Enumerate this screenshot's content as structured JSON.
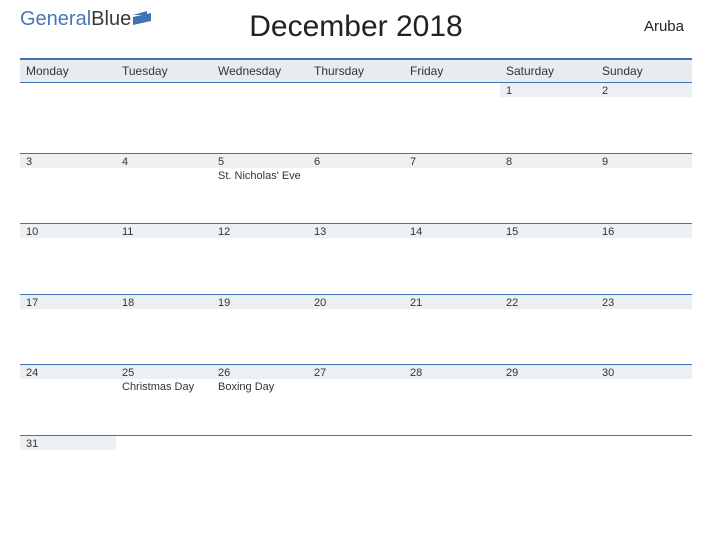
{
  "header": {
    "logo_part1": "General",
    "logo_part2": "Blue",
    "title": "December 2018",
    "region": "Aruba"
  },
  "day_headers": [
    "Monday",
    "Tuesday",
    "Wednesday",
    "Thursday",
    "Friday",
    "Saturday",
    "Sunday"
  ],
  "weeks": [
    {
      "days": [
        {
          "num": "",
          "event": ""
        },
        {
          "num": "",
          "event": ""
        },
        {
          "num": "",
          "event": ""
        },
        {
          "num": "",
          "event": ""
        },
        {
          "num": "",
          "event": ""
        },
        {
          "num": "1",
          "event": ""
        },
        {
          "num": "2",
          "event": ""
        }
      ]
    },
    {
      "days": [
        {
          "num": "3",
          "event": ""
        },
        {
          "num": "4",
          "event": ""
        },
        {
          "num": "5",
          "event": "St. Nicholas' Eve"
        },
        {
          "num": "6",
          "event": ""
        },
        {
          "num": "7",
          "event": ""
        },
        {
          "num": "8",
          "event": ""
        },
        {
          "num": "9",
          "event": ""
        }
      ]
    },
    {
      "days": [
        {
          "num": "10",
          "event": ""
        },
        {
          "num": "11",
          "event": ""
        },
        {
          "num": "12",
          "event": ""
        },
        {
          "num": "13",
          "event": ""
        },
        {
          "num": "14",
          "event": ""
        },
        {
          "num": "15",
          "event": ""
        },
        {
          "num": "16",
          "event": ""
        }
      ]
    },
    {
      "days": [
        {
          "num": "17",
          "event": ""
        },
        {
          "num": "18",
          "event": ""
        },
        {
          "num": "19",
          "event": ""
        },
        {
          "num": "20",
          "event": ""
        },
        {
          "num": "21",
          "event": ""
        },
        {
          "num": "22",
          "event": ""
        },
        {
          "num": "23",
          "event": ""
        }
      ]
    },
    {
      "days": [
        {
          "num": "24",
          "event": ""
        },
        {
          "num": "25",
          "event": "Christmas Day"
        },
        {
          "num": "26",
          "event": "Boxing Day"
        },
        {
          "num": "27",
          "event": ""
        },
        {
          "num": "28",
          "event": ""
        },
        {
          "num": "29",
          "event": ""
        },
        {
          "num": "30",
          "event": ""
        }
      ]
    },
    {
      "days": [
        {
          "num": "31",
          "event": ""
        },
        {
          "num": "",
          "event": ""
        },
        {
          "num": "",
          "event": ""
        },
        {
          "num": "",
          "event": ""
        },
        {
          "num": "",
          "event": ""
        },
        {
          "num": "",
          "event": ""
        },
        {
          "num": "",
          "event": ""
        }
      ]
    }
  ]
}
